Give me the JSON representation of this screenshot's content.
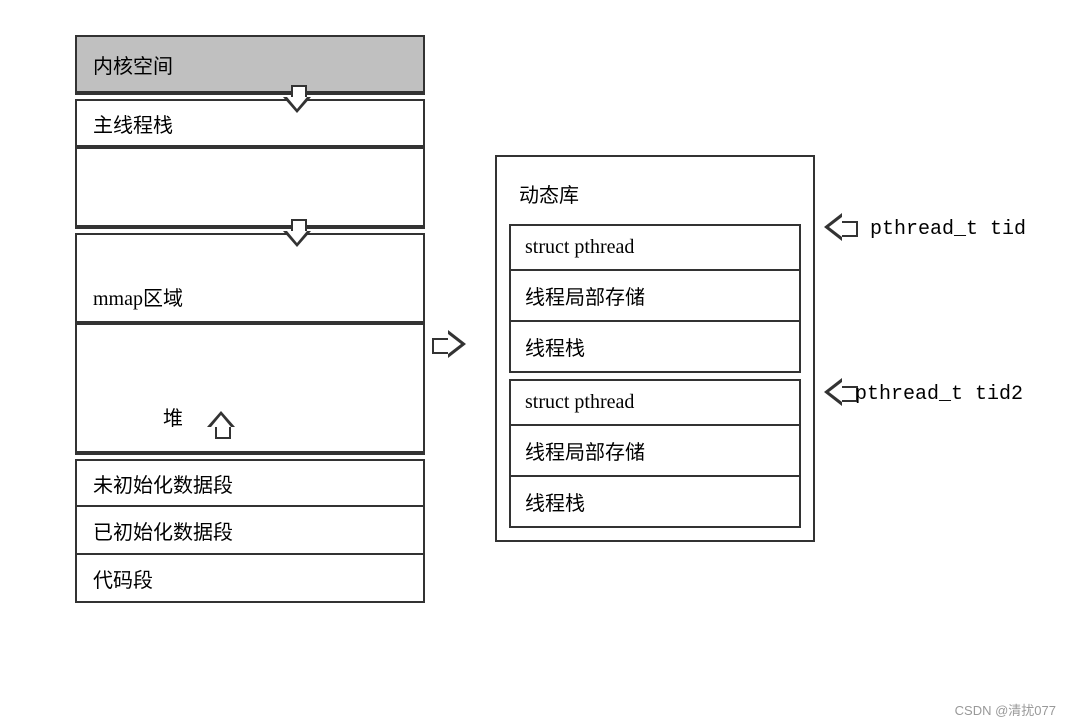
{
  "memory_layout": {
    "kernel_space": "内核空间",
    "main_thread_stack": "主线程栈",
    "mmap_region": "mmap区域",
    "heap": "堆",
    "bss_segment": "未初始化数据段",
    "data_segment": "已初始化数据段",
    "code_segment": "代码段"
  },
  "thread_detail": {
    "dynamic_lib": "动态库",
    "struct_pthread": "struct pthread",
    "tls": "线程局部存储",
    "thread_stack": "线程栈"
  },
  "pointers": {
    "tid1": "pthread_t tid",
    "tid2": "pthread_t tid2"
  },
  "watermark": "CSDN @清扰077"
}
